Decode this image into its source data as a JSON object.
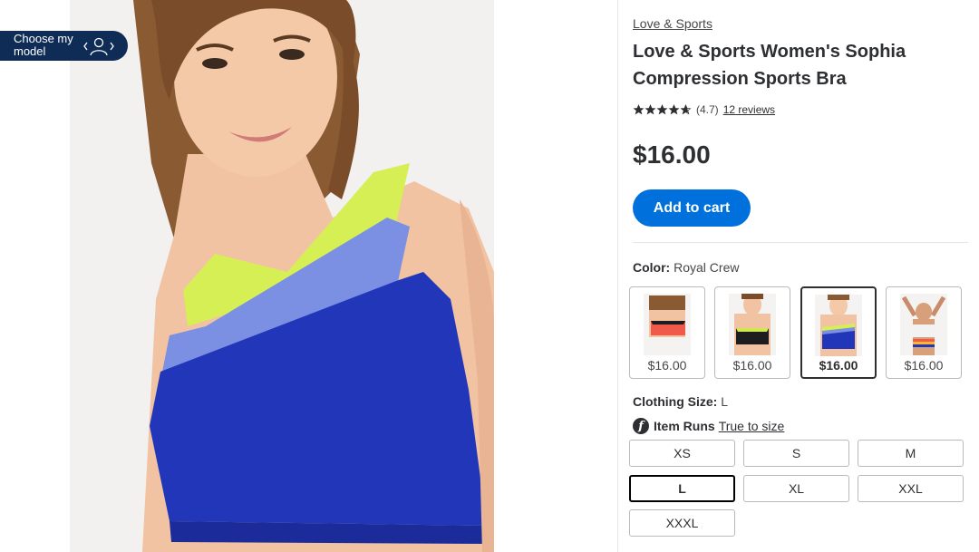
{
  "gallery": {
    "choose_model_label": "Choose my model"
  },
  "product": {
    "brand": "Love & Sports",
    "title": "Love & Sports Women's Sophia Compression Sports Bra",
    "rating_value": "(4.7)",
    "rating_stars": 4.7,
    "reviews_label": "12 reviews",
    "price": "$16.00",
    "add_to_cart_label": "Add to cart"
  },
  "color": {
    "label": "Color:",
    "selected": "Royal Crew",
    "swatches": [
      {
        "name": "coral",
        "price": "$16.00",
        "selected": false,
        "accent": "#f05a4a"
      },
      {
        "name": "black",
        "price": "$16.00",
        "selected": false,
        "accent": "#1d1d1f"
      },
      {
        "name": "royal-crew",
        "price": "$16.00",
        "selected": true,
        "accent": "#2136b8"
      },
      {
        "name": "white-stripe",
        "price": "$16.00",
        "selected": false,
        "accent": "#f2f2f2"
      }
    ]
  },
  "size": {
    "label": "Clothing Size:",
    "selected": "L",
    "fit_label": "Item Runs",
    "fit_value": "True to size",
    "options": [
      "XS",
      "S",
      "M",
      "L",
      "XL",
      "XXL",
      "XXXL"
    ]
  },
  "colors": {
    "primary_blue": "#0071dc",
    "navy": "#0f2c57",
    "text": "#2e2f32"
  }
}
